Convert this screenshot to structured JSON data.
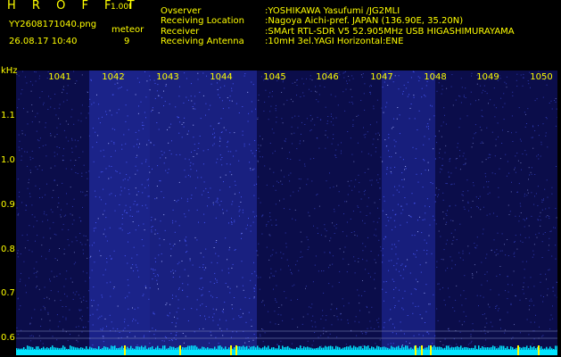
{
  "header": {
    "app_title": "H R O F F T",
    "version": "1.00f",
    "filename": "YY2608171040.png",
    "timestamp": "26.08.17 10:40",
    "mode": "meteor",
    "count": "9"
  },
  "info": [
    {
      "label": "Ovserver",
      "value": ":YOSHIKAWA Yasufumi /JG2MLI"
    },
    {
      "label": "Receiving Location",
      "value": ":Nagoya Aichi-pref. JAPAN (136.90E, 35.20N)"
    },
    {
      "label": "Receiver",
      "value": ":SMArt RTL-SDR V5 52.905MHz USB HIGASHIMURAYAMA"
    },
    {
      "label": "Receiving Antenna",
      "value": ":10mH 3el.YAGI Horizontal:ENE"
    }
  ],
  "spectrogram": {
    "freq_unit": "kHz",
    "freq_labels": [
      "1041",
      "1042",
      "1043",
      "1044",
      "1045",
      "1046",
      "1047",
      "1048",
      "1049",
      "1050"
    ],
    "y_labels": [
      "1.1",
      "1.0",
      "0.9",
      "0.8",
      "0.7",
      "0.6"
    ],
    "colors": {
      "background": "#0b0d4a",
      "noise": "#3a4cff",
      "baseline": "#00e5ff",
      "label": "#ffff00"
    }
  }
}
